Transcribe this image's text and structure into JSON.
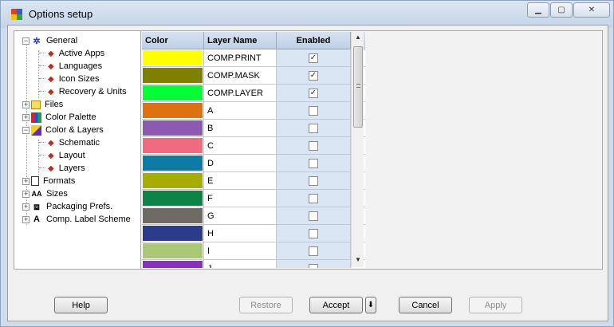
{
  "window": {
    "title": "Options setup"
  },
  "tree": {
    "items": [
      {
        "label": "General",
        "icon": "gear-cluster-icon",
        "expander": "−"
      },
      {
        "label": "Active Apps"
      },
      {
        "label": "Languages"
      },
      {
        "label": "Icon Sizes"
      },
      {
        "label": "Recovery & Units"
      },
      {
        "label": "Files",
        "icon": "folder-icon",
        "expander": "+"
      },
      {
        "label": "Color Palette",
        "icon": "palette-icon",
        "expander": "+"
      },
      {
        "label": "Color & Layers",
        "icon": "color-layers-icon",
        "expander": "−"
      },
      {
        "label": "Schematic"
      },
      {
        "label": "Layout"
      },
      {
        "label": "Layers"
      },
      {
        "label": "Formats",
        "icon": "document-icon",
        "expander": "+"
      },
      {
        "label": "Sizes",
        "icon": "sizes-icon",
        "glyph": "AA",
        "expander": "+"
      },
      {
        "label": "Packaging Prefs.",
        "icon": "package-icon",
        "expander": "+"
      },
      {
        "label": "Comp. Label Scheme",
        "icon": "label-icon",
        "glyph": "A",
        "expander": "+"
      }
    ]
  },
  "table": {
    "headers": {
      "color": "Color",
      "name": "Layer Name",
      "enabled": "Enabled"
    },
    "rows": [
      {
        "color": "#ffff00",
        "name": "COMP.PRINT",
        "enabled": true
      },
      {
        "color": "#808000",
        "name": "COMP.MASK",
        "enabled": true
      },
      {
        "color": "#00ff33",
        "name": "COMP.LAYER",
        "enabled": true
      },
      {
        "color": "#de7211",
        "name": "A",
        "enabled": false
      },
      {
        "color": "#8c5ab0",
        "name": "B",
        "enabled": false
      },
      {
        "color": "#f06a80",
        "name": "C",
        "enabled": false
      },
      {
        "color": "#0f7aa3",
        "name": "D",
        "enabled": false
      },
      {
        "color": "#a4ad00",
        "name": "E",
        "enabled": false
      },
      {
        "color": "#0b8446",
        "name": "F",
        "enabled": false
      },
      {
        "color": "#6e6a64",
        "name": "G",
        "enabled": false
      },
      {
        "color": "#2d3b8c",
        "name": "H",
        "enabled": false
      },
      {
        "color": "#a9c977",
        "name": "I",
        "enabled": false
      },
      {
        "color": "#8b2fc0",
        "name": "J",
        "enabled": false
      }
    ]
  },
  "buttons": {
    "help": "Help",
    "restore": "Restore",
    "accept": "Accept",
    "cancel": "Cancel",
    "apply": "Apply"
  }
}
